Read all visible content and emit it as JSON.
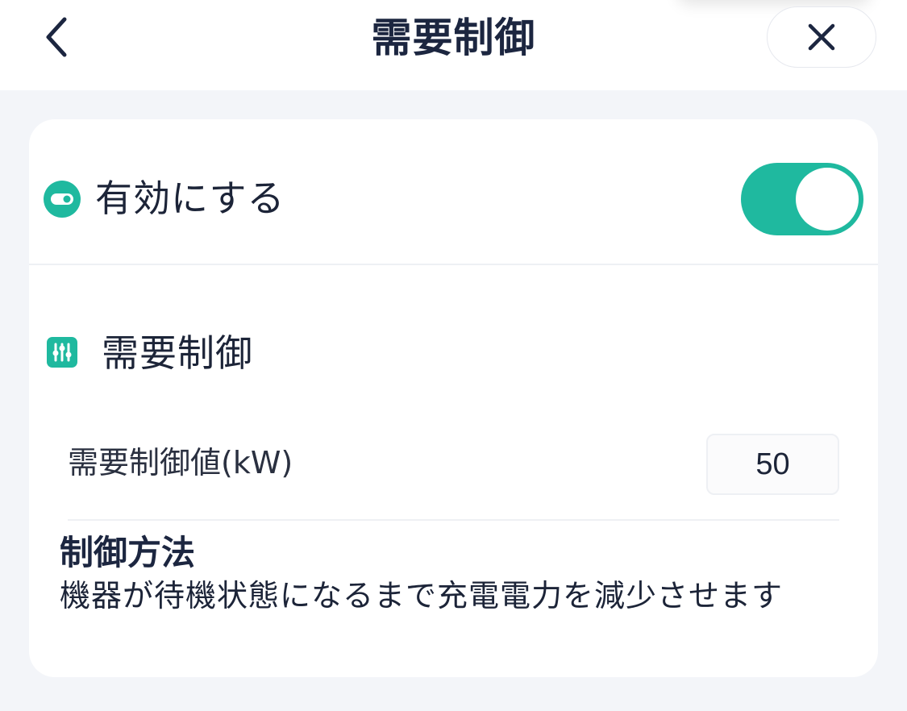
{
  "header": {
    "title": "需要制御",
    "back_icon": "chevron-left-icon",
    "close_icon": "close-icon"
  },
  "enable": {
    "label": "有効にする",
    "icon": "toggle-icon",
    "enabled": true,
    "accent_color": "#1fb99f"
  },
  "section": {
    "label": "需要制御",
    "icon": "sliders-icon"
  },
  "demand_value": {
    "label": "需要制御値(kW)",
    "value": "50"
  },
  "method": {
    "title": "制御方法",
    "description": "機器が待機状態になるまで充電電力を減少させます"
  }
}
